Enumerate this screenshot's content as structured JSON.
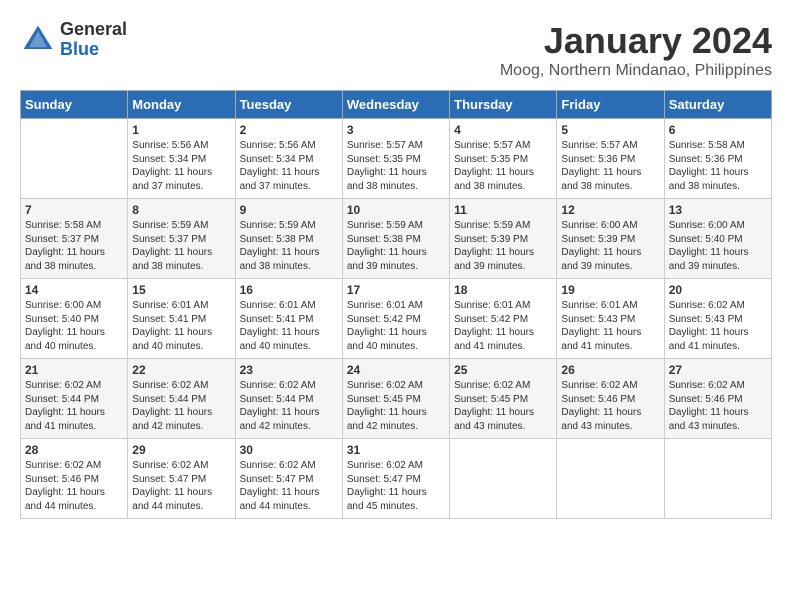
{
  "header": {
    "logo_general": "General",
    "logo_blue": "Blue",
    "month_year": "January 2024",
    "location": "Moog, Northern Mindanao, Philippines"
  },
  "weekdays": [
    "Sunday",
    "Monday",
    "Tuesday",
    "Wednesday",
    "Thursday",
    "Friday",
    "Saturday"
  ],
  "weeks": [
    [
      {
        "day": "",
        "info": ""
      },
      {
        "day": "1",
        "info": "Sunrise: 5:56 AM\nSunset: 5:34 PM\nDaylight: 11 hours\nand 37 minutes."
      },
      {
        "day": "2",
        "info": "Sunrise: 5:56 AM\nSunset: 5:34 PM\nDaylight: 11 hours\nand 37 minutes."
      },
      {
        "day": "3",
        "info": "Sunrise: 5:57 AM\nSunset: 5:35 PM\nDaylight: 11 hours\nand 38 minutes."
      },
      {
        "day": "4",
        "info": "Sunrise: 5:57 AM\nSunset: 5:35 PM\nDaylight: 11 hours\nand 38 minutes."
      },
      {
        "day": "5",
        "info": "Sunrise: 5:57 AM\nSunset: 5:36 PM\nDaylight: 11 hours\nand 38 minutes."
      },
      {
        "day": "6",
        "info": "Sunrise: 5:58 AM\nSunset: 5:36 PM\nDaylight: 11 hours\nand 38 minutes."
      }
    ],
    [
      {
        "day": "7",
        "info": "Sunrise: 5:58 AM\nSunset: 5:37 PM\nDaylight: 11 hours\nand 38 minutes."
      },
      {
        "day": "8",
        "info": "Sunrise: 5:59 AM\nSunset: 5:37 PM\nDaylight: 11 hours\nand 38 minutes."
      },
      {
        "day": "9",
        "info": "Sunrise: 5:59 AM\nSunset: 5:38 PM\nDaylight: 11 hours\nand 38 minutes."
      },
      {
        "day": "10",
        "info": "Sunrise: 5:59 AM\nSunset: 5:38 PM\nDaylight: 11 hours\nand 39 minutes."
      },
      {
        "day": "11",
        "info": "Sunrise: 5:59 AM\nSunset: 5:39 PM\nDaylight: 11 hours\nand 39 minutes."
      },
      {
        "day": "12",
        "info": "Sunrise: 6:00 AM\nSunset: 5:39 PM\nDaylight: 11 hours\nand 39 minutes."
      },
      {
        "day": "13",
        "info": "Sunrise: 6:00 AM\nSunset: 5:40 PM\nDaylight: 11 hours\nand 39 minutes."
      }
    ],
    [
      {
        "day": "14",
        "info": "Sunrise: 6:00 AM\nSunset: 5:40 PM\nDaylight: 11 hours\nand 40 minutes."
      },
      {
        "day": "15",
        "info": "Sunrise: 6:01 AM\nSunset: 5:41 PM\nDaylight: 11 hours\nand 40 minutes."
      },
      {
        "day": "16",
        "info": "Sunrise: 6:01 AM\nSunset: 5:41 PM\nDaylight: 11 hours\nand 40 minutes."
      },
      {
        "day": "17",
        "info": "Sunrise: 6:01 AM\nSunset: 5:42 PM\nDaylight: 11 hours\nand 40 minutes."
      },
      {
        "day": "18",
        "info": "Sunrise: 6:01 AM\nSunset: 5:42 PM\nDaylight: 11 hours\nand 41 minutes."
      },
      {
        "day": "19",
        "info": "Sunrise: 6:01 AM\nSunset: 5:43 PM\nDaylight: 11 hours\nand 41 minutes."
      },
      {
        "day": "20",
        "info": "Sunrise: 6:02 AM\nSunset: 5:43 PM\nDaylight: 11 hours\nand 41 minutes."
      }
    ],
    [
      {
        "day": "21",
        "info": "Sunrise: 6:02 AM\nSunset: 5:44 PM\nDaylight: 11 hours\nand 41 minutes."
      },
      {
        "day": "22",
        "info": "Sunrise: 6:02 AM\nSunset: 5:44 PM\nDaylight: 11 hours\nand 42 minutes."
      },
      {
        "day": "23",
        "info": "Sunrise: 6:02 AM\nSunset: 5:44 PM\nDaylight: 11 hours\nand 42 minutes."
      },
      {
        "day": "24",
        "info": "Sunrise: 6:02 AM\nSunset: 5:45 PM\nDaylight: 11 hours\nand 42 minutes."
      },
      {
        "day": "25",
        "info": "Sunrise: 6:02 AM\nSunset: 5:45 PM\nDaylight: 11 hours\nand 43 minutes."
      },
      {
        "day": "26",
        "info": "Sunrise: 6:02 AM\nSunset: 5:46 PM\nDaylight: 11 hours\nand 43 minutes."
      },
      {
        "day": "27",
        "info": "Sunrise: 6:02 AM\nSunset: 5:46 PM\nDaylight: 11 hours\nand 43 minutes."
      }
    ],
    [
      {
        "day": "28",
        "info": "Sunrise: 6:02 AM\nSunset: 5:46 PM\nDaylight: 11 hours\nand 44 minutes."
      },
      {
        "day": "29",
        "info": "Sunrise: 6:02 AM\nSunset: 5:47 PM\nDaylight: 11 hours\nand 44 minutes."
      },
      {
        "day": "30",
        "info": "Sunrise: 6:02 AM\nSunset: 5:47 PM\nDaylight: 11 hours\nand 44 minutes."
      },
      {
        "day": "31",
        "info": "Sunrise: 6:02 AM\nSunset: 5:47 PM\nDaylight: 11 hours\nand 45 minutes."
      },
      {
        "day": "",
        "info": ""
      },
      {
        "day": "",
        "info": ""
      },
      {
        "day": "",
        "info": ""
      }
    ]
  ]
}
